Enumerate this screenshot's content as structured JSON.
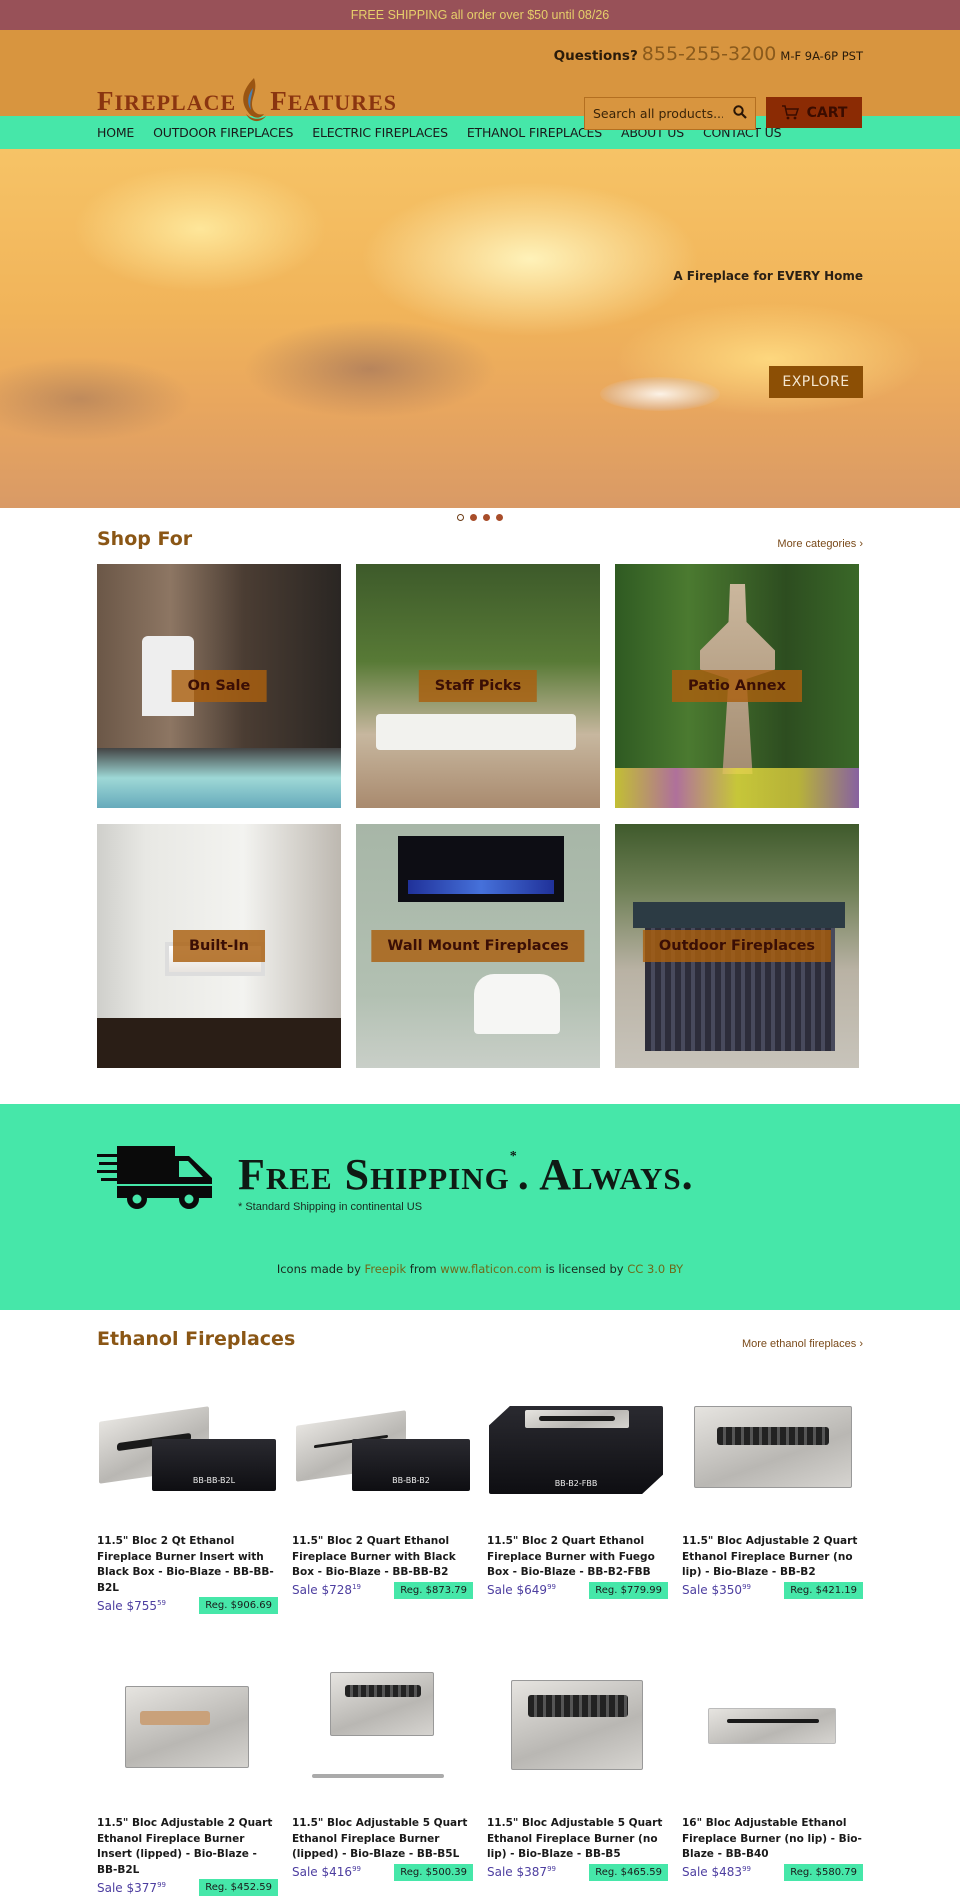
{
  "announcement": "FREE SHIPPING all order over $50 until 08/26",
  "header": {
    "logo_left": "Fireplace",
    "logo_right": "Features",
    "questions_label": "Questions?",
    "phone": "855-255-3200",
    "hours": "M-F 9A-6P PST",
    "search_placeholder": "Search all products...",
    "cart_label": "CART",
    "icons": {
      "search": "search-icon",
      "cart": "cart-icon",
      "logo": "flame-icon"
    }
  },
  "nav": {
    "items": [
      {
        "label": "HOME"
      },
      {
        "label": "OUTDOOR FIREPLACES"
      },
      {
        "label": "ELECTRIC FIREPLACES"
      },
      {
        "label": "ETHANOL FIREPLACES"
      },
      {
        "label": "ABOUT US"
      },
      {
        "label": "CONTACT US"
      }
    ]
  },
  "hero": {
    "tagline": "A Fireplace for EVERY Home",
    "button_label": "EXPLORE",
    "slides_count": 4,
    "active_slide": 1
  },
  "shop_for": {
    "title": "Shop For",
    "more_link": "More categories ›",
    "tiles": [
      {
        "label": "On Sale"
      },
      {
        "label": "Staff Picks"
      },
      {
        "label": "Patio Annex"
      },
      {
        "label": "Built-In"
      },
      {
        "label": "Wall Mount Fireplaces"
      },
      {
        "label": "Outdoor Fireplaces"
      }
    ]
  },
  "shipping_banner": {
    "headline_part1": "Free Shipping",
    "asterisk": "*",
    "headline_part2": ". Always.",
    "note": "* Standard Shipping in continental US",
    "credit": {
      "prefix": "Icons made by",
      "author": "Freepik",
      "from": "from",
      "site": "www.flaticon.com",
      "licensed": "is licensed by",
      "license": "CC 3.0 BY"
    },
    "icon": "delivery-truck-icon"
  },
  "ethanol": {
    "title": "Ethanol Fireplaces",
    "more_link": "More ethanol fireplaces ›",
    "products": [
      {
        "title": "11.5\" Bloc 2 Qt Ethanol Fireplace Burner Insert with Black Box - Bio-Blaze - BB-BB-B2L",
        "sale_prefix": "Sale",
        "sale_dollars": "$755",
        "sale_cents": "59",
        "regular": "Reg. $906.69",
        "image_label": "BB-BB-B2L"
      },
      {
        "title": "11.5\" Bloc 2 Quart Ethanol Fireplace Burner with Black Box - Bio-Blaze - BB-BB-B2",
        "sale_prefix": "Sale",
        "sale_dollars": "$728",
        "sale_cents": "19",
        "regular": "Reg. $873.79",
        "image_label": "BB-BB-B2"
      },
      {
        "title": "11.5\" Bloc 2 Quart Ethanol Fireplace Burner with Fuego Box - Bio-Blaze - BB-B2-FBB",
        "sale_prefix": "Sale",
        "sale_dollars": "$649",
        "sale_cents": "99",
        "regular": "Reg. $779.99",
        "image_label": "BB-B2-FBB"
      },
      {
        "title": "11.5\" Bloc Adjustable 2 Quart Ethanol Fireplace Burner (no lip) - Bio-Blaze - BB-B2",
        "sale_prefix": "Sale",
        "sale_dollars": "$350",
        "sale_cents": "99",
        "regular": "Reg. $421.19",
        "image_label": ""
      },
      {
        "title": "11.5\" Bloc Adjustable 2 Quart Ethanol Fireplace Burner Insert (lipped) - Bio-Blaze - BB-B2L",
        "sale_prefix": "Sale",
        "sale_dollars": "$377",
        "sale_cents": "99",
        "regular": "Reg. $452.59",
        "image_label": ""
      },
      {
        "title": "11.5\" Bloc Adjustable 5 Quart Ethanol Fireplace Burner (lipped) - Bio-Blaze - BB-B5L",
        "sale_prefix": "Sale",
        "sale_dollars": "$416",
        "sale_cents": "99",
        "regular": "Reg. $500.39",
        "image_label": ""
      },
      {
        "title": "11.5\" Bloc Adjustable 5 Quart Ethanol Fireplace Burner (no lip) - Bio-Blaze - BB-B5",
        "sale_prefix": "Sale",
        "sale_dollars": "$387",
        "sale_cents": "99",
        "regular": "Reg. $465.59",
        "image_label": ""
      },
      {
        "title": "16\" Bloc Adjustable Ethanol Fireplace Burner (no lip) - Bio-Blaze - BB-B40",
        "sale_prefix": "Sale",
        "sale_dollars": "$483",
        "sale_cents": "99",
        "regular": "Reg. $580.79",
        "image_label": ""
      }
    ]
  },
  "colors": {
    "announcement_bg": "#985158",
    "announcement_text": "#e6cf6a",
    "header_bg": "#d8953f",
    "nav_bg": "#46e7a9",
    "cart_bg": "#8b2b04",
    "explore_bg": "#8c4f05",
    "section_title": "#8a5615",
    "sale_price": "#4d3ea0",
    "reg_badge": "#46e7a9"
  }
}
